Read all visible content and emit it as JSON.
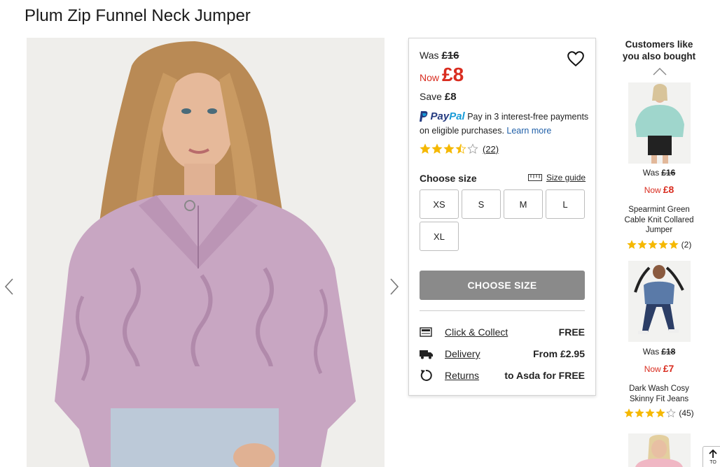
{
  "product": {
    "title": "Plum Zip Funnel Neck Jumper"
  },
  "pricing": {
    "was_label": "Was",
    "was_amount": "£16",
    "now_label": "Now",
    "now_amount": "£8",
    "save_label": "Save",
    "save_amount": "£8"
  },
  "paypal": {
    "brand_pay": "Pay",
    "brand_pal": "Pal",
    "text": "Pay in 3 interest-free payments on eligible purchases.",
    "learn_more": "Learn more"
  },
  "rating": {
    "stars": 3.5,
    "count_label": "(22)"
  },
  "sizes": {
    "heading": "Choose size",
    "guide_label": "Size guide",
    "options": [
      "XS",
      "S",
      "M",
      "L",
      "XL"
    ]
  },
  "cta": {
    "choose_size_label": "CHOOSE SIZE"
  },
  "delivery": [
    {
      "icon": "store-icon",
      "label": "Click & Collect",
      "value": "FREE"
    },
    {
      "icon": "truck-icon",
      "label": "Delivery",
      "value": "From £2.95"
    },
    {
      "icon": "returns-icon",
      "label": "Returns",
      "value": "to Asda for FREE"
    }
  ],
  "recommendations": {
    "title": "Customers like you also bought",
    "items": [
      {
        "was_label": "Was",
        "was_amount": "£16",
        "now_label": "Now",
        "now_amount": "£8",
        "name": "Spearmint Green Cable Knit Collared Jumper",
        "stars": 5,
        "count_label": "(2)"
      },
      {
        "was_label": "Was",
        "was_amount": "£18",
        "now_label": "Now",
        "now_amount": "£7",
        "name": "Dark Wash Cosy Skinny Fit Jeans",
        "stars": 4,
        "count_label": "(45)"
      }
    ]
  },
  "back_to_top": {
    "label": "TO"
  },
  "colors": {
    "sale_red": "#d92d20",
    "star_gold": "#f5b800",
    "cta_grey": "#8a8a8a",
    "paypal_navy": "#253b80",
    "paypal_blue": "#179bd7",
    "jumper_plum": "#c8a6c2"
  }
}
